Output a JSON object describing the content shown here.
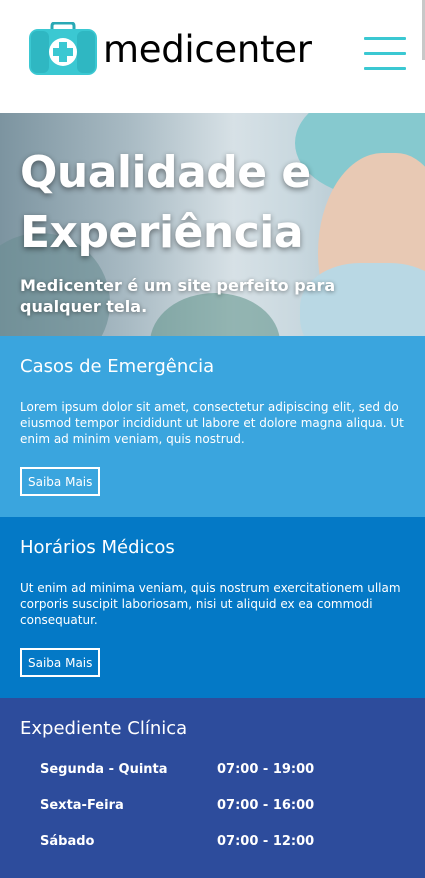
{
  "header": {
    "logo_text": "medicenter",
    "logo_icon": "medical-bag-icon",
    "menu_icon": "hamburger-menu-icon",
    "accent_color": "#3bc8d2"
  },
  "hero": {
    "title": "Qualidade e Experiência",
    "subtitle": "Medicenter é um site perfeito para qualquer tela."
  },
  "panels": [
    {
      "title": "Casos de Emergência",
      "text": "Lorem ipsum dolor sit amet, consectetur adipiscing elit, sed do eiusmod tempor incididunt ut labore et dolore magna aliqua. Ut enim ad minim veniam, quis nostrud.",
      "button": "Saiba Mais",
      "color": "#3aa5de"
    },
    {
      "title": "Horários Médicos",
      "text": "Ut enim ad minima veniam, quis nostrum exercitationem ullam corporis suscipit laboriosam, nisi ut aliquid ex ea commodi consequatur.",
      "button": "Saiba Mais",
      "color": "#0479c6"
    },
    {
      "title": "Expediente Clínica",
      "color": "#2d4c9c",
      "schedule": [
        {
          "days": "Segunda - Quinta",
          "hours": "07:00 - 19:00"
        },
        {
          "days": "Sexta-Feira",
          "hours": "07:00 - 16:00"
        },
        {
          "days": "Sábado",
          "hours": "07:00 - 12:00"
        }
      ]
    }
  ]
}
